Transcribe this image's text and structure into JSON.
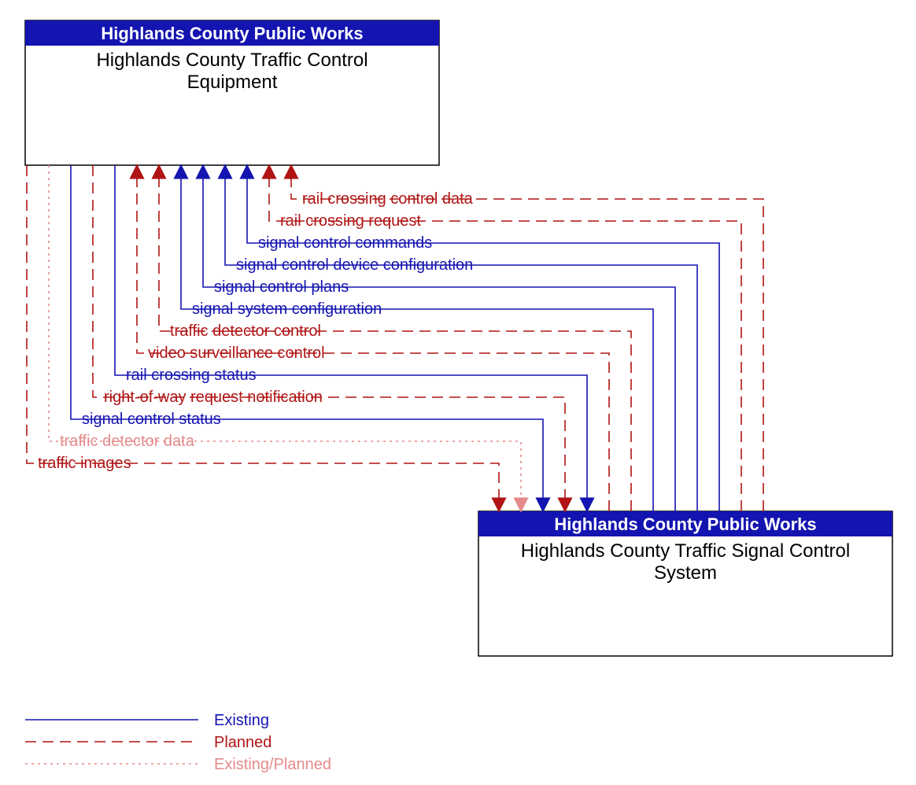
{
  "boxes": {
    "top_left": {
      "header": "Highlands County Public Works",
      "body_line1": "Highlands County Traffic Control",
      "body_line2": "Equipment"
    },
    "bottom_right": {
      "header": "Highlands County Public Works",
      "body_line1": "Highlands County Traffic Signal Control",
      "body_line2": "System"
    }
  },
  "flows_to_top": [
    {
      "label": "rail crossing control data",
      "style": "planned",
      "color": "#b01414"
    },
    {
      "label": "rail crossing request",
      "style": "planned",
      "color": "#b01414"
    },
    {
      "label": "signal control commands",
      "style": "existing",
      "color": "#1414b0"
    },
    {
      "label": "signal control device configuration",
      "style": "existing",
      "color": "#1414b0"
    },
    {
      "label": "signal control plans",
      "style": "existing",
      "color": "#1414b0"
    },
    {
      "label": "signal system configuration",
      "style": "existing",
      "color": "#1414b0"
    },
    {
      "label": "traffic detector control",
      "style": "planned",
      "color": "#b01414"
    },
    {
      "label": "video surveillance control",
      "style": "planned",
      "color": "#b01414"
    }
  ],
  "flows_to_bottom": [
    {
      "label": "rail crossing status",
      "style": "existing",
      "color": "#1414b0"
    },
    {
      "label": "right-of-way request notification",
      "style": "planned",
      "color": "#b01414"
    },
    {
      "label": "signal control status",
      "style": "existing",
      "color": "#1414b0"
    },
    {
      "label": "traffic detector data",
      "style": "ep",
      "color": "#e58a8a"
    },
    {
      "label": "traffic images",
      "style": "planned",
      "color": "#b01414"
    }
  ],
  "legend": {
    "existing": "Existing",
    "planned": "Planned",
    "ep": "Existing/Planned"
  },
  "colors": {
    "existing": "#1414b0",
    "planned": "#b01414",
    "ep": "#e58a8a",
    "header_bg": "#1414b0"
  }
}
